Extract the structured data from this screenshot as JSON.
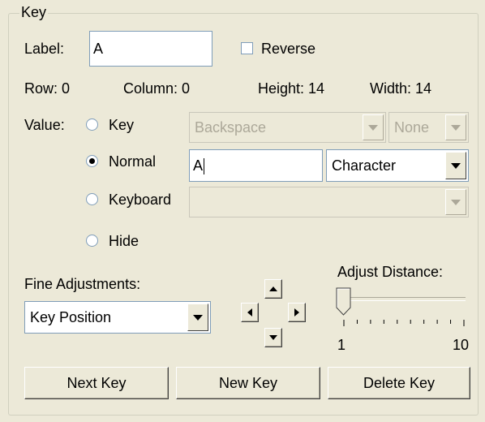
{
  "group": {
    "title": "Key"
  },
  "label_field": {
    "label": "Label:",
    "value": "A"
  },
  "reverse": {
    "label": "Reverse",
    "checked": false
  },
  "info": {
    "row": "Row: 0",
    "column": "Column: 0",
    "height": "Height: 14",
    "width": "Width: 14"
  },
  "value": {
    "label": "Value:",
    "options": [
      {
        "label": "Key",
        "selected": false
      },
      {
        "label": "Normal",
        "selected": true
      },
      {
        "label": "Keyboard",
        "selected": false
      },
      {
        "label": "Hide",
        "selected": false
      }
    ],
    "key_select": "Backspace",
    "modifier_select": "None",
    "normal_text": "A",
    "normal_type": "Character",
    "keyboard_select": ""
  },
  "fine": {
    "label": "Fine Adjustments:",
    "selected": "Key Position"
  },
  "distance": {
    "label": "Adjust Distance:",
    "min": "1",
    "max": "10",
    "value": 1
  },
  "buttons": {
    "next": "Next Key",
    "new": "New Key",
    "delete": "Delete Key"
  },
  "colors": {
    "face": "#ECE9D8",
    "border": "#7F9DB9",
    "disabled_text": "#ACA899"
  }
}
